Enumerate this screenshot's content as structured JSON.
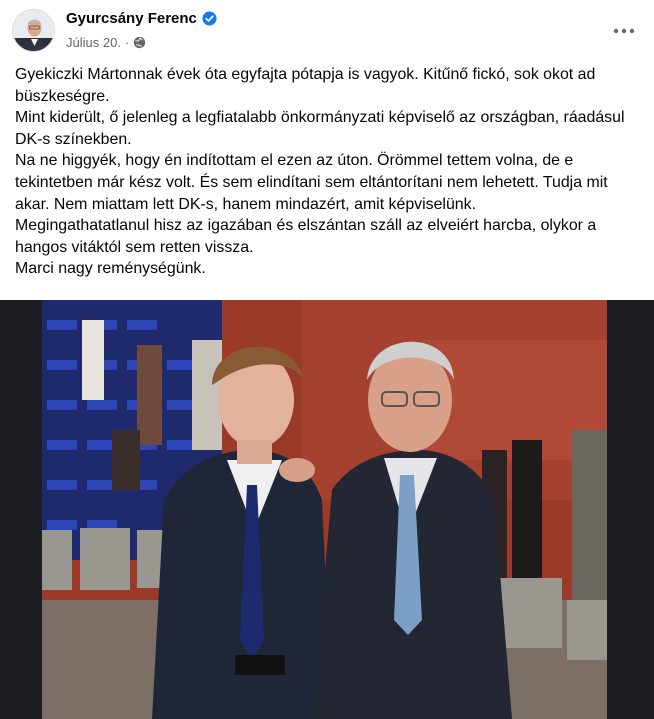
{
  "post": {
    "author": "Gyurcsány Ferenc",
    "date": "Július 20.",
    "separator": "·",
    "paragraphs": [
      "Gyekiczki Mártonnak évek óta egyfajta pótapja is vagyok. Kitűnő fickó, sok okot ad büszkeségre.",
      "Mint kiderült, ő jelenleg a legfiatalabb önkormányzati képviselő az országban, ráadásul DK-s színekben.",
      "Na ne higgyék, hogy én indítottam el ezen az úton. Örömmel tettem volna, de e tekintetben már kész volt. És sem elindítani sem eltántorítani nem lehetett. Tudja mit akar. Nem miattam lett DK-s, hanem mindazért, amit képviselünk.",
      "Megingathatatlanul hisz az igazában és elszántan száll az elveiért harcba, olykor a hangos vitáktól sem retten vissza.",
      "Marci nagy reménységünk."
    ]
  },
  "icons": {
    "verified": "verified-badge-icon",
    "audience": "globe-icon",
    "more": "more-options-icon"
  },
  "colors": {
    "verified": "#1877f2",
    "meta_text": "#65676b",
    "text": "#050505"
  }
}
